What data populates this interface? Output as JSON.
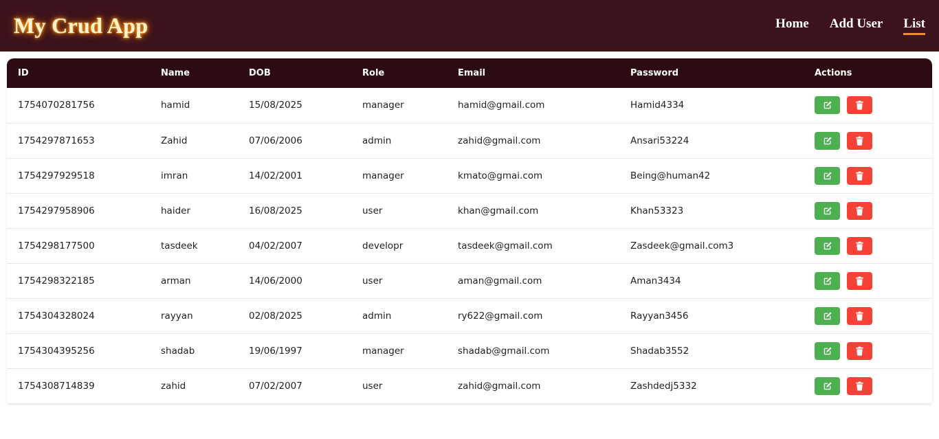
{
  "app": {
    "title": "My Crud App"
  },
  "nav": {
    "items": [
      {
        "label": "Home",
        "active": false
      },
      {
        "label": "Add User",
        "active": false
      },
      {
        "label": "List",
        "active": true
      }
    ]
  },
  "table": {
    "headers": [
      "ID",
      "Name",
      "DOB",
      "Role",
      "Email",
      "Password",
      "Actions"
    ],
    "rows": [
      {
        "id": "1754070281756",
        "name": "hamid",
        "dob": "15/08/2025",
        "role": "manager",
        "email": "hamid@gmail.com",
        "password": "Hamid4334"
      },
      {
        "id": "1754297871653",
        "name": "Zahid",
        "dob": "07/06/2006",
        "role": "admin",
        "email": "zahid@gmail.com",
        "password": "Ansari53224"
      },
      {
        "id": "1754297929518",
        "name": "imran",
        "dob": "14/02/2001",
        "role": "manager",
        "email": "kmato@gmai.com",
        "password": "Being@human42"
      },
      {
        "id": "1754297958906",
        "name": "haider",
        "dob": "16/08/2025",
        "role": "user",
        "email": "khan@gmail.com",
        "password": "Khan53323"
      },
      {
        "id": "1754298177500",
        "name": "tasdeek",
        "dob": "04/02/2007",
        "role": "developr",
        "email": "tasdeek@gmail.com",
        "password": "Zasdeek@gmail.com3"
      },
      {
        "id": "1754298322185",
        "name": "arman",
        "dob": "14/06/2000",
        "role": "user",
        "email": "aman@gmail.com",
        "password": "Aman3434"
      },
      {
        "id": "1754304328024",
        "name": "rayyan",
        "dob": "02/08/2025",
        "role": "admin",
        "email": "ry622@gmail.com",
        "password": "Rayyan3456"
      },
      {
        "id": "1754304395256",
        "name": "shadab",
        "dob": "19/06/1997",
        "role": "manager",
        "email": "shadab@gmail.com",
        "password": "Shadab3552"
      },
      {
        "id": "1754308714839",
        "name": "zahid",
        "dob": "07/02/2007",
        "role": "user",
        "email": "zahid@gmail.com",
        "password": "Zashdedj5332"
      }
    ],
    "actions": {
      "edit_icon": "edit-icon",
      "delete_icon": "trash-icon"
    }
  },
  "colors": {
    "navbar_bg": "#3c121b",
    "header_bg": "#2d0b12",
    "edit_button": "#4caf50",
    "delete_button": "#f44336",
    "active_underline": "#f28c28"
  }
}
